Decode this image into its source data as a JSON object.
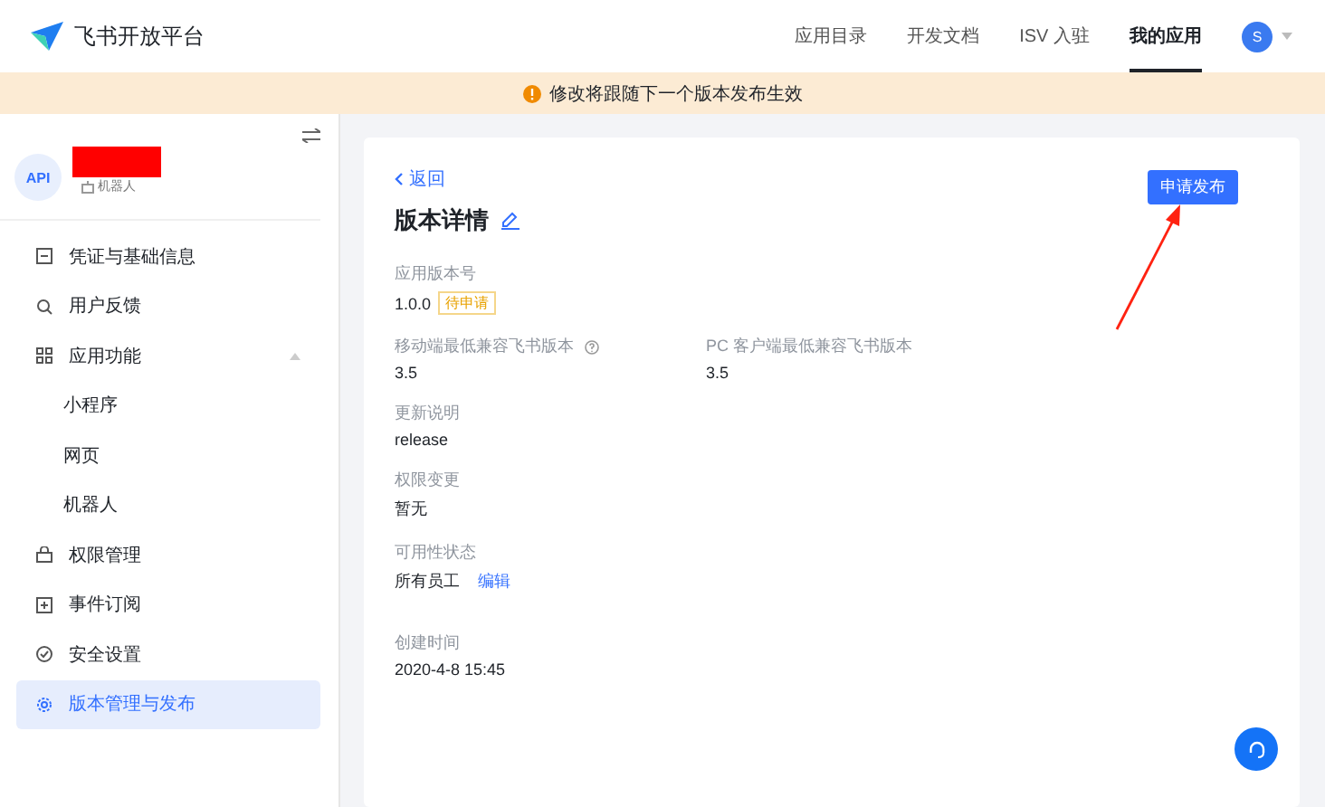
{
  "header": {
    "logo_text": "飞书开放平台",
    "nav": [
      {
        "label": "应用目录",
        "selected": false
      },
      {
        "label": "开发文档",
        "selected": false
      },
      {
        "label": "ISV 入驻",
        "selected": false
      },
      {
        "label": "我的应用",
        "selected": true
      }
    ],
    "avatar": "S"
  },
  "banner": {
    "text": "修改将跟随下一个版本发布生效"
  },
  "sidebar": {
    "app_avatar": "API",
    "app_type": "机器人",
    "items": [
      {
        "label": "凭证与基础信息",
        "kind": "item",
        "selected": false
      },
      {
        "label": "用户反馈",
        "kind": "item",
        "selected": false
      },
      {
        "label": "应用功能",
        "kind": "item",
        "selected": false,
        "expanded": true,
        "children": [
          {
            "label": "小程序",
            "selected": false
          },
          {
            "label": "网页",
            "selected": false
          },
          {
            "label": "机器人",
            "selected": false
          }
        ]
      },
      {
        "label": "权限管理",
        "kind": "item",
        "selected": false
      },
      {
        "label": "事件订阅",
        "kind": "item",
        "selected": false
      },
      {
        "label": "安全设置",
        "kind": "item",
        "selected": false
      },
      {
        "label": "版本管理与发布",
        "kind": "item",
        "selected": true
      }
    ]
  },
  "detail": {
    "back": "返回",
    "title": "版本详情",
    "action": "申请发布",
    "rows": [
      [
        {
          "label": "应用版本号",
          "value": "1.0.0",
          "tag": "待申请"
        }
      ],
      [
        {
          "label": "移动端最低兼容飞书版本",
          "value": "3.5",
          "help": true
        },
        {
          "label": "PC 客户端最低兼容飞书版本",
          "value": "3.5"
        }
      ],
      [
        {
          "label": "更新说明",
          "value": "release"
        }
      ],
      [
        {
          "label": "权限变更",
          "value": "暂无"
        }
      ],
      [
        {
          "label": "可用性状态",
          "value": "所有员工",
          "link": "编辑"
        }
      ],
      [
        {
          "label": "创建时间",
          "value": "2020-4-8 15:45"
        }
      ]
    ]
  }
}
